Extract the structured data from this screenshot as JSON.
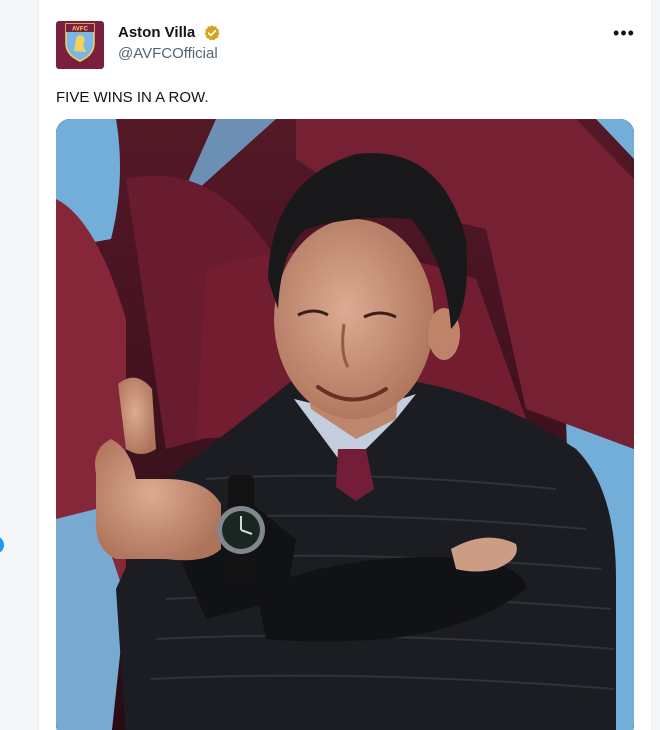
{
  "account": {
    "name": "Aston Villa",
    "handle": "@AVFCOfficial",
    "avatar_text": "AVFC",
    "verified_badge_color": "#d4a420",
    "brand_color": "#7a1f3d"
  },
  "menu": {
    "icon": "more-horizontal-icon",
    "label": "•••"
  },
  "tweet": {
    "text": "FIVE WINS IN A ROW."
  },
  "media": {
    "description_icon": "photo"
  },
  "colors": {
    "link_blue": "#1d9bf0",
    "text": "#0f1419",
    "muted": "#536471"
  }
}
